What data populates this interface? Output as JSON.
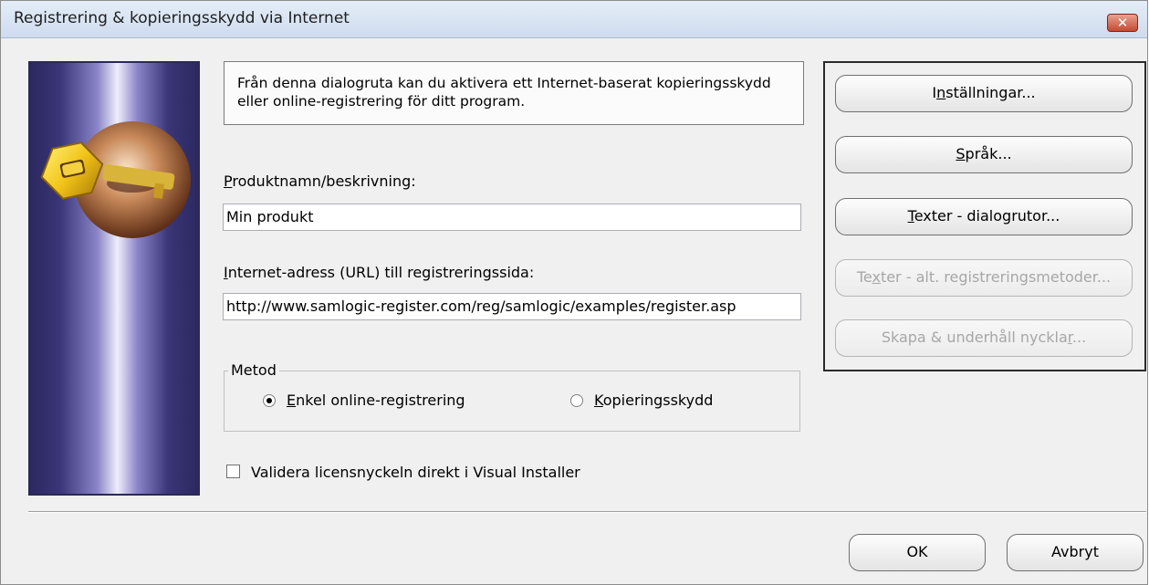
{
  "window": {
    "title": "Registrering & kopieringsskydd via Internet",
    "close_glyph": "✕"
  },
  "info": {
    "text": "Från denna dialogruta kan du aktivera ett Internet-baserat kopieringsskydd eller online-registrering för ditt program."
  },
  "product": {
    "label_key": "P",
    "label_rest": "roduktnamn/beskrivning:",
    "value": "Min produkt"
  },
  "url": {
    "label_key": "I",
    "label_rest": "nternet-adress (URL) till registreringssida:",
    "value": "http://www.samlogic-register.com/reg/samlogic/examples/register.asp"
  },
  "method": {
    "legend": "Metod",
    "option1": {
      "key": "E",
      "rest": "nkel online-registrering",
      "selected": true
    },
    "option2": {
      "key": "K",
      "rest": "opieringsskydd",
      "selected": false
    }
  },
  "validate": {
    "label": "Validera licensnyckeln direkt i Visual Installer",
    "checked": false
  },
  "buttons": {
    "settings": {
      "pre": "I",
      "key": "n",
      "post": "ställningar..."
    },
    "language": {
      "pre": "",
      "key": "S",
      "post": "pråk..."
    },
    "texts_dialogs": {
      "pre": "",
      "key": "T",
      "post": "exter - dialogrutor..."
    },
    "texts_alt": {
      "pre": "Te",
      "key": "x",
      "post": "ter - alt. registreringsmetoder..."
    },
    "keys": {
      "pre": "Skapa & underhåll nyckla",
      "key": "r",
      "post": "..."
    },
    "ok": "OK",
    "cancel": "Avbryt"
  },
  "colors": {
    "banner_dark": "#2c2860",
    "banner_light": "#eeeefa",
    "key_gold": "#f2c418",
    "close_red": "#c44a30"
  }
}
